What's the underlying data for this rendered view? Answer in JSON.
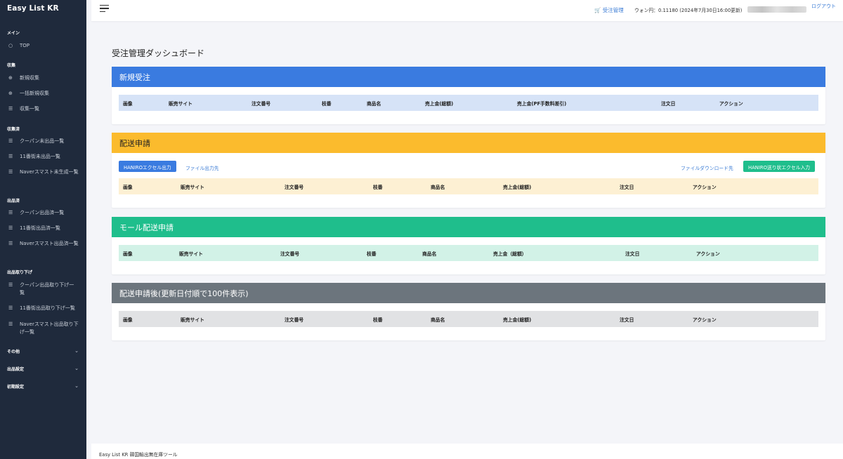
{
  "sidebar": {
    "brand": "Easy List KR",
    "sections": {
      "main": "メイン",
      "collect": "収集",
      "collected": "収集済",
      "listed": "出品済",
      "withdraw": "出品取り下げ"
    },
    "items": {
      "top": "TOP",
      "new_collect": "新規収集",
      "bulk_collect": "一括新規収集",
      "collect_list": "収集一覧",
      "coupang_unlisted": "クーパン未出品一覧",
      "st11_unlisted": "11番街未出品一覧",
      "naver_ungenerated": "Naverスマスト未生成一覧",
      "coupang_listed": "クーパン出品済一覧",
      "st11_listed": "11番街出品済一覧",
      "naver_listed": "Naverスマスト出品済一覧",
      "coupang_withdraw": "クーパン出品取り下げ一覧",
      "st11_withdraw": "11番街出品取り下げ一覧",
      "naver_withdraw": "Naverスマスト出品取り下げ一覧"
    },
    "collapsibles": {
      "other": "その他",
      "listing_settings": "出品設定",
      "initial_settings": "初期設定"
    }
  },
  "topbar": {
    "order_management": "受注管理",
    "rate": "ウォン円：0.11180 (2024年7月30日16:00更新)",
    "logout": "ログアウト"
  },
  "page_title": "受注管理ダッシュボード",
  "cards": {
    "new_orders": {
      "title": "新規受注",
      "columns": [
        "画像",
        "販売サイト",
        "注文番号",
        "枝番",
        "商品名",
        "売上金(総額)",
        "売上金(PF手数料差引)",
        "注文日",
        "アクション"
      ]
    },
    "shipping": {
      "title": "配送申請",
      "btn_excel_out": "HANIROエクセル出力",
      "link_file_dest": "ファイル出力先",
      "link_file_download": "ファイルダウンロード先",
      "btn_tracking_in": "HANIRO送り状エクセル入力",
      "columns": [
        "画像",
        "販売サイト",
        "注文番号",
        "枝番",
        "商品名",
        "売上金(総額)",
        "注文日",
        "アクション"
      ]
    },
    "mall_shipping": {
      "title": "モール配送申請",
      "columns": [
        "画像",
        "販売サイト",
        "注文番号",
        "枝番",
        "商品名",
        "売上金（総額）",
        "注文日",
        "アクション"
      ]
    },
    "after_shipping": {
      "title": "配送申請後(更新日付順で100件表示)",
      "columns": [
        "画像",
        "販売サイト",
        "注文番号",
        "枝番",
        "商品名",
        "売上金(総額)",
        "注文日",
        "アクション"
      ]
    }
  },
  "footer": "Easy List KR 韓国輸出無在庫ツール",
  "colors": {
    "sidebar_bg": "#1f2a3c",
    "blue": "#3a7be0",
    "yellow": "#fbbb2d",
    "green": "#1fbe8c",
    "gray": "#6c757d"
  }
}
